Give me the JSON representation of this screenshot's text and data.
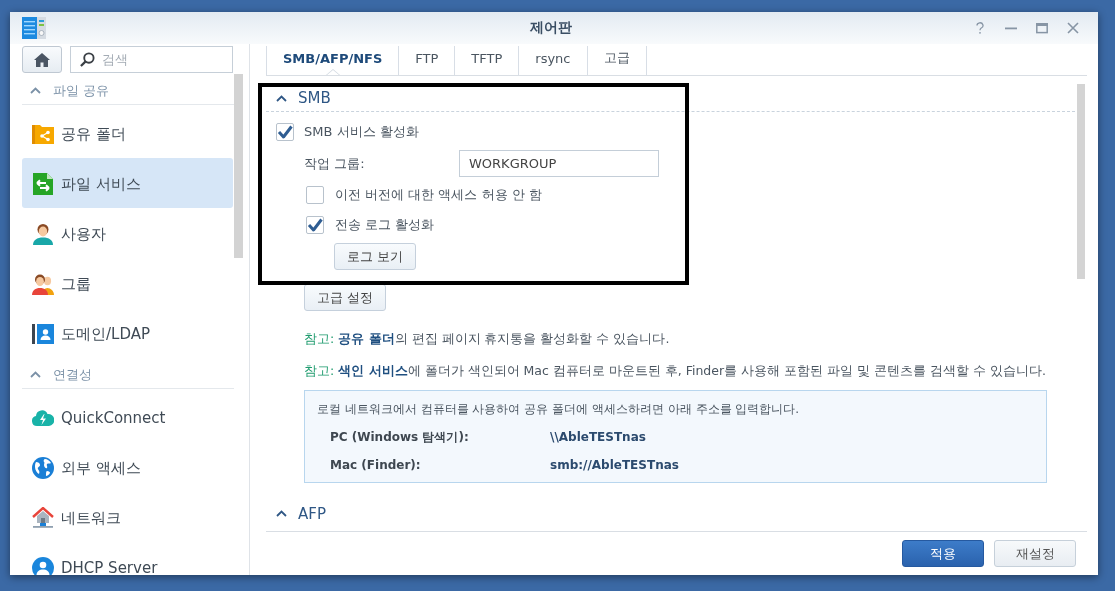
{
  "window": {
    "title": "제어판"
  },
  "sidebar": {
    "search": {
      "placeholder": "검색"
    },
    "sections": [
      {
        "title": "파일 공유",
        "expanded": true,
        "items": [
          {
            "label": "공유 폴더",
            "selected": false
          },
          {
            "label": "파일 서비스",
            "selected": true
          },
          {
            "label": "사용자",
            "selected": false
          },
          {
            "label": "그룹",
            "selected": false
          },
          {
            "label": "도메인/LDAP",
            "selected": false
          }
        ]
      },
      {
        "title": "연결성",
        "expanded": true,
        "items": [
          {
            "label": "QuickConnect",
            "selected": false
          },
          {
            "label": "외부 액세스",
            "selected": false
          },
          {
            "label": "네트워크",
            "selected": false
          },
          {
            "label": "DHCP Server",
            "selected": false
          }
        ]
      }
    ]
  },
  "tabs": [
    {
      "label": "SMB/AFP/NFS",
      "selected": true
    },
    {
      "label": "FTP",
      "selected": false
    },
    {
      "label": "TFTP",
      "selected": false
    },
    {
      "label": "rsync",
      "selected": false
    },
    {
      "label": "고급",
      "selected": false
    }
  ],
  "smb": {
    "title": "SMB",
    "expanded": true,
    "enable": {
      "label": "SMB 서비스 활성화",
      "checked": true
    },
    "workgroup": {
      "label": "작업 그룹:",
      "value": "WORKGROUP"
    },
    "options": [
      {
        "label": "이전 버전에 대한 액세스 허용 안 함",
        "checked": false
      },
      {
        "label": "전송 로그 활성화",
        "checked": true
      }
    ],
    "log_button": "로그 보기",
    "advanced_button": "고급 설정",
    "notes": [
      {
        "label": "참고:",
        "text": "**공유 폴더**의 편집 페이지 휴지통을 활성화할 수 있습니다."
      },
      {
        "label": "참고:",
        "text": "**색인 서비스**에 폴더가 색인되어 Mac 컴퓨터로 마운트된 후, Finder를 사용해 포함된 파일 및 콘텐츠를 검색할 수 있습니다."
      }
    ],
    "address_box": {
      "intro": "로컬 네트워크에서 컴퓨터를 사용하여 공유 폴더에 액세스하려면 아래 주소를 입력합니다.",
      "rows": [
        {
          "label": "PC (Windows 탐색기):",
          "value": "\\\\AbleTESTnas"
        },
        {
          "label": "Mac (Finder):",
          "value": "smb://AbleTESTnas"
        }
      ]
    }
  },
  "afp": {
    "title": "AFP",
    "expanded": true
  },
  "footer": {
    "buttons": [
      {
        "label": "적용",
        "kind": "primary"
      },
      {
        "label": "재설정",
        "kind": "secondary"
      }
    ]
  }
}
